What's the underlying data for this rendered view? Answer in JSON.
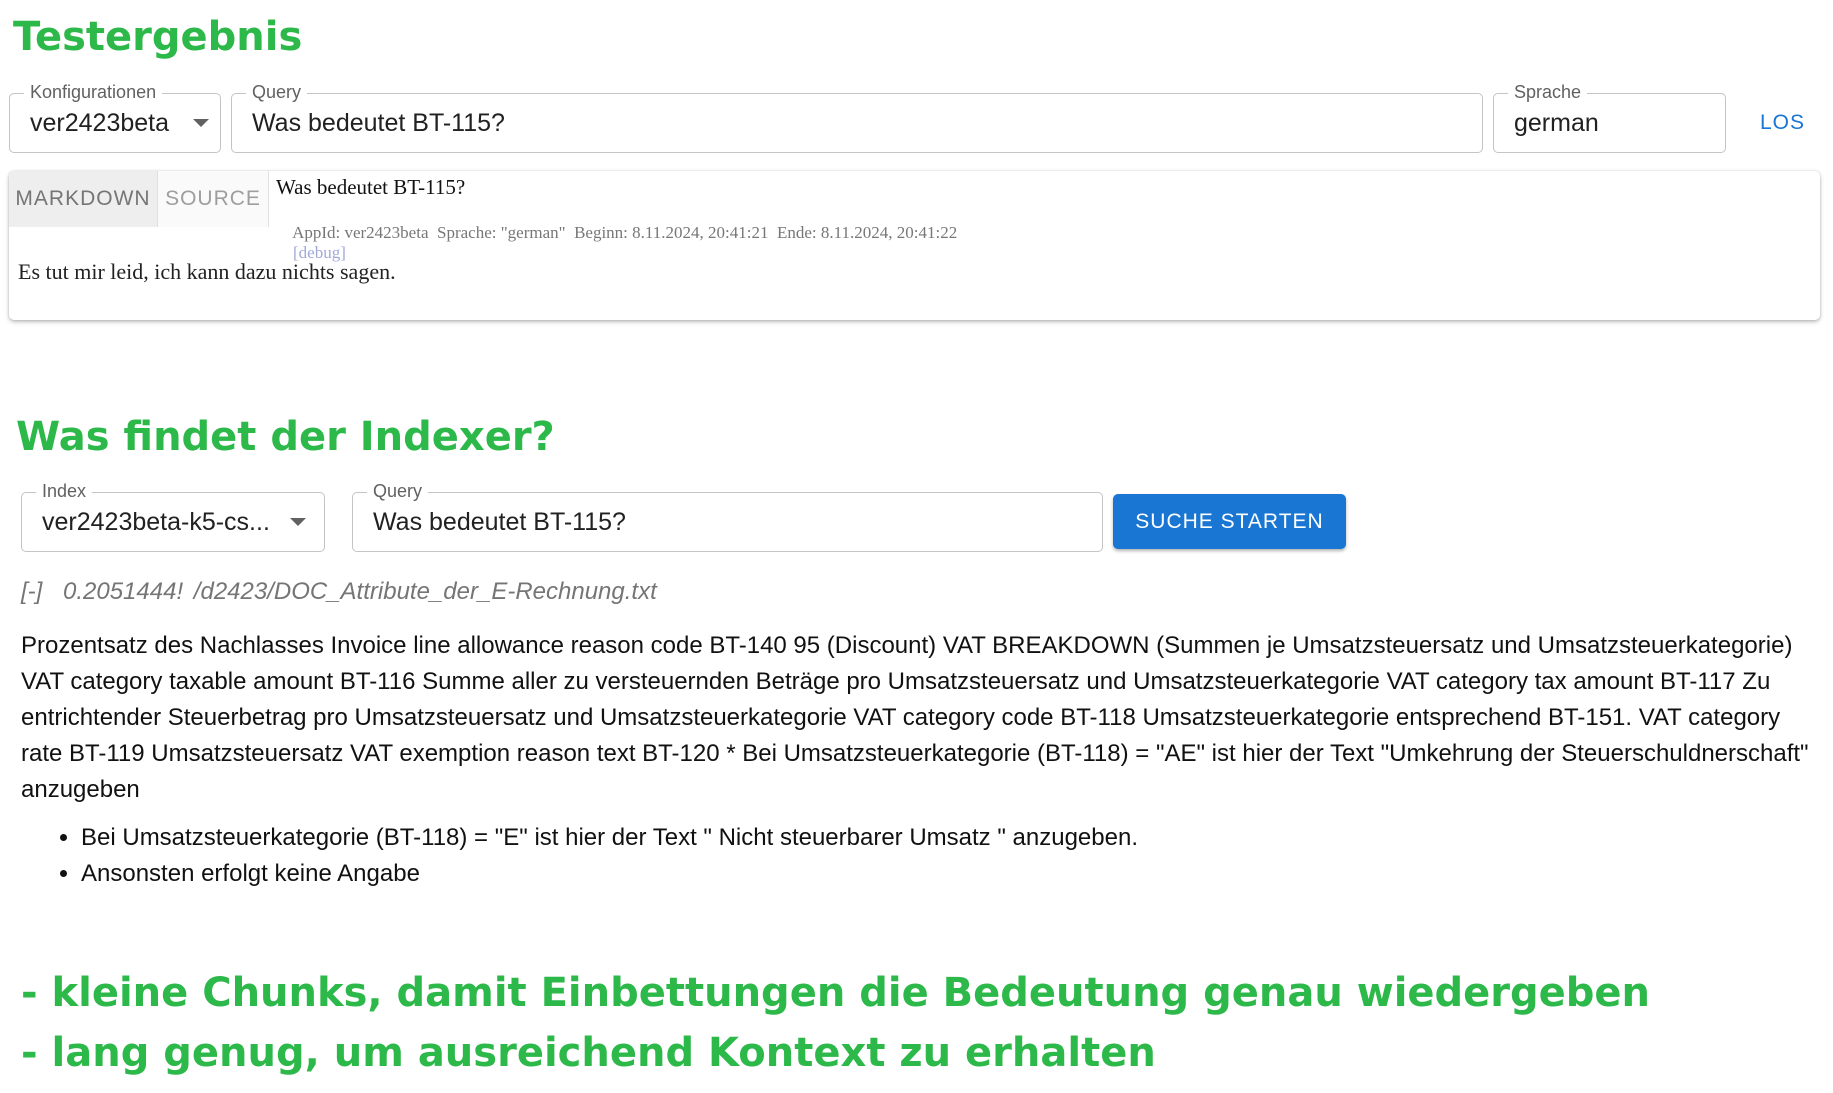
{
  "section1": {
    "title": "Testergebnis",
    "config": {
      "label": "Konfigurationen",
      "value": "ver2423beta"
    },
    "query": {
      "label": "Query",
      "value": "Was bedeutet BT-115?"
    },
    "language": {
      "label": "Sprache",
      "value": "german"
    },
    "go_label": "LOS"
  },
  "result": {
    "tabs": [
      "MARKDOWN",
      "SOURCE"
    ],
    "question": "Was bedeutet BT-115?",
    "meta": "AppId: ver2423beta  Sprache: \"german\"  Beginn: 8.11.2024, 20:41:21  Ende: 8.11.2024, 20:41:22",
    "debug_label": "[debug]",
    "answer": "Es tut mir leid, ich kann dazu nichts sagen."
  },
  "section2": {
    "title": "Was findet der Indexer?",
    "index": {
      "label": "Index",
      "value": "ver2423beta-k5-cs..."
    },
    "query": {
      "label": "Query",
      "value": "Was bedeutet BT-115?"
    },
    "search_label": "SUCHE STARTEN"
  },
  "hit": {
    "toggle": "[-]",
    "score": "0.2051444!",
    "path": "/d2423/DOC_Attribute_der_E-Rechnung.txt",
    "text": "Prozentsatz des Nachlasses Invoice line allowance reason code BT-140 95 (Discount) VAT BREAKDOWN (Summen je Umsatzsteuersatz und Umsatzsteuerkategorie) VAT category taxable amount BT-116 Summe aller zu versteuernden Beträge pro Umsatzsteuersatz und Umsatzsteuerkategorie VAT category tax amount BT-117 Zu entrichtender Steuerbetrag pro Umsatzsteuersatz und Umsatzsteuerkategorie VAT category code BT-118 Umsatzsteuerkategorie entsprechend BT-151. VAT category rate BT-119 Umsatzsteuersatz VAT exemption reason text BT-120 * Bei Umsatzsteuerkategorie (BT-118) = \"AE\" ist hier der Text \"Umkehrung der Steuerschuldnerschaft\" anzugeben",
    "bullets": [
      "Bei Umsatzsteuerkategorie (BT-118) = \"E\" ist hier der Text \" Nicht steuerbarer Umsatz \" anzugeben.",
      "Ansonsten erfolgt keine Angabe"
    ]
  },
  "notes": [
    "- kleine Chunks, damit Einbettungen die Bedeutung genau wiedergeben",
    "- lang genug, um ausreichend Kontext zu erhalten"
  ],
  "colors": {
    "heading": "#2db84a",
    "accent": "#1976d2"
  },
  "icons": {
    "dropdown": "chevron-down-icon"
  }
}
